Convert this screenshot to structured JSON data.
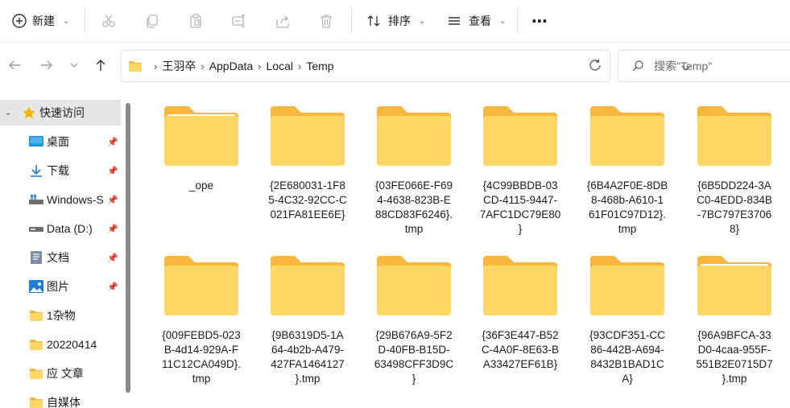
{
  "toolbar": {
    "new_label": "新建",
    "cut": "cut-icon",
    "copy": "copy-icon",
    "paste": "paste-icon",
    "rename": "rename-icon",
    "share": "share-icon",
    "delete": "delete-icon",
    "sort_label": "排序",
    "view_label": "查看",
    "more": "⋯"
  },
  "address": {
    "crumbs": [
      "王羽卒",
      "AppData",
      "Local",
      "Temp"
    ],
    "search_placeholder": "搜索\"Temp\""
  },
  "sidebar": {
    "items": [
      {
        "label": "快速访问",
        "icon": "star-icon",
        "selected": true
      },
      {
        "label": "桌面",
        "icon": "desktop-icon",
        "pinned": true
      },
      {
        "label": "下载",
        "icon": "download-icon",
        "pinned": true
      },
      {
        "label": "Windows-S",
        "icon": "drive-c-icon",
        "pinned": true
      },
      {
        "label": "Data (D:)",
        "icon": "drive-icon",
        "pinned": true
      },
      {
        "label": "文档",
        "icon": "documents-icon",
        "pinned": true
      },
      {
        "label": "图片",
        "icon": "pictures-icon",
        "pinned": true
      },
      {
        "label": "1杂物",
        "icon": "folder-icon"
      },
      {
        "label": "20220414",
        "icon": "folder-icon"
      },
      {
        "label": "应 文章",
        "icon": "folder-icon"
      },
      {
        "label": "自媒体",
        "icon": "folder-icon"
      }
    ]
  },
  "files": [
    {
      "name": "_ope",
      "paper": true
    },
    {
      "name": "{2E680031-1F85-4C32-92CC-C021FA81EE6E}"
    },
    {
      "name": "{03FE066E-F694-4638-823B-E88CD83F6246}.tmp"
    },
    {
      "name": "{4C99BBDB-03CD-4115-9447-7AFC1DC79E80}"
    },
    {
      "name": "{6B4A2F0E-8DB8-468b-A610-161F01C97D12}.tmp"
    },
    {
      "name": "{6B5DD224-3AC0-4EDD-834B-7BC797E37068}"
    },
    {
      "name": "{009FEBD5-023B-4d14-929A-F11C12CA049D}.tmp"
    },
    {
      "name": "{9B6319D5-1A64-4b2b-A479-427FA1464127}.tmp"
    },
    {
      "name": "{29B676A9-5F2D-40FB-B15D-63498CFF3D9C}"
    },
    {
      "name": "{36F3E447-B52C-4A0F-8E63-BA33427EF61B}"
    },
    {
      "name": "{93CDF351-CC86-442B-A694-8432B1BAD1CA}"
    },
    {
      "name": "{96A9BFCA-33D0-4caa-955F-551B2E0715D7}.tmp",
      "paper": true
    }
  ],
  "file_lines": [
    [
      "_ope"
    ],
    [
      "{2E680031-1F8",
      "5-4C32-92CC-C",
      "021FA81EE6E}"
    ],
    [
      "{03FE066E-F69",
      "4-4638-823B-E",
      "88CD83F6246}.",
      "tmp"
    ],
    [
      "{4C99BBDB-03",
      "CD-4115-9447-",
      "7AFC1DC79E80",
      "}"
    ],
    [
      "{6B4A2F0E-8DB",
      "8-468b-A610-1",
      "61F01C97D12}.",
      "tmp"
    ],
    [
      "{6B5DD224-3A",
      "C0-4EDD-834B",
      "-7BC797E3706",
      "8}"
    ],
    [
      "{009FEBD5-023",
      "B-4d14-929A-F",
      "11C12CA049D}.",
      "tmp"
    ],
    [
      "{9B6319D5-1A",
      "64-4b2b-A479-",
      "427FA1464127",
      "}.tmp"
    ],
    [
      "{29B676A9-5F2",
      "D-40FB-B15D-",
      "63498CFF3D9C",
      "}"
    ],
    [
      "{36F3E447-B52",
      "C-4A0F-8E63-B",
      "A33427EF61B}"
    ],
    [
      "{93CDF351-CC",
      "86-442B-A694-",
      "8432B1BAD1C",
      "A}"
    ],
    [
      "{96A9BFCA-33",
      "D0-4caa-955F-",
      "551B2E0715D7",
      "}.tmp"
    ]
  ],
  "colors": {
    "folder_back": "#f6b73c",
    "folder_front": "#ffd766",
    "selected_bg": "#e6e6e6",
    "accent": "#0067c0"
  }
}
